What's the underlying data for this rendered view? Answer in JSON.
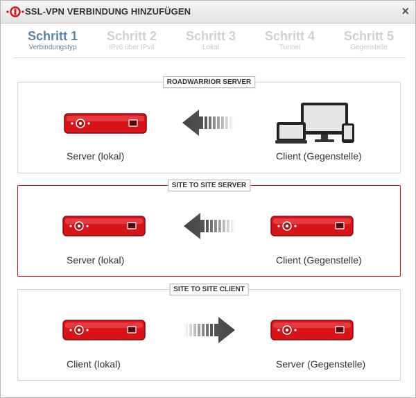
{
  "window": {
    "title": "SSL-VPN VERBINDUNG HINZUFÜGEN",
    "close_icon": "close-icon"
  },
  "steps": [
    {
      "num": "Schritt 1",
      "sub": "Verbindungstyp",
      "active": true
    },
    {
      "num": "Schritt 2",
      "sub": "IPv6 über IPv4",
      "active": false
    },
    {
      "num": "Schritt 3",
      "sub": "Lokal",
      "active": false
    },
    {
      "num": "Schritt 4",
      "sub": "Tunnel",
      "active": false
    },
    {
      "num": "Schritt 5",
      "sub": "Gegenstelle",
      "active": false
    }
  ],
  "options": [
    {
      "title": "ROADWARRIOR SERVER",
      "left_label": "Server (lokal)",
      "right_label": "Client (Gegenstelle)",
      "arrow": "left",
      "selected": false
    },
    {
      "title": "SITE TO SITE SERVER",
      "left_label": "Server (lokal)",
      "right_label": "Client (Gegenstelle)",
      "arrow": "left",
      "selected": true
    },
    {
      "title": "SITE TO SITE CLIENT",
      "left_label": "Client (lokal)",
      "right_label": "Server (Gegenstelle)",
      "arrow": "right",
      "selected": false
    }
  ],
  "colors": {
    "accent_red": "#d7141a",
    "step_active": "#5b84a8",
    "step_inactive": "#d0d0d0"
  }
}
